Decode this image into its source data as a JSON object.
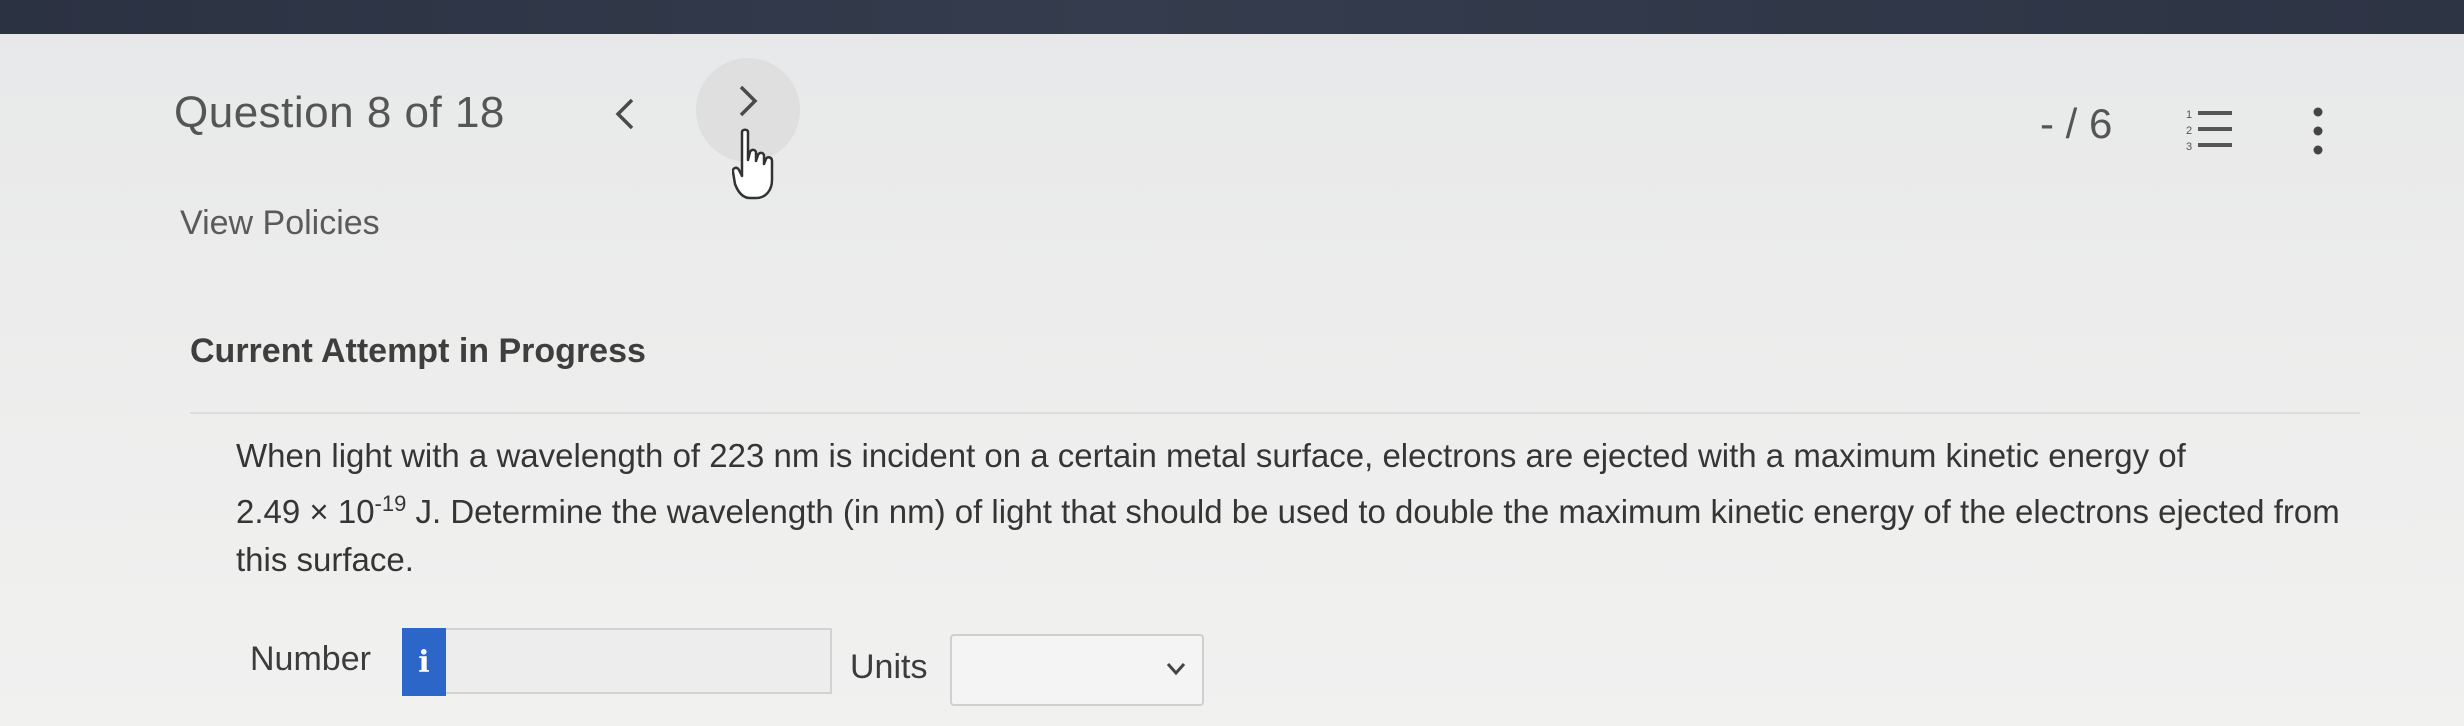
{
  "header": {
    "question_counter": "Question 8 of 18",
    "prev_icon": "chevron-left-icon",
    "next_icon": "chevron-right-icon",
    "score": "- / 6",
    "list_icon": "numbered-list-icon",
    "more_icon": "more-vertical-icon"
  },
  "view_policies": "View Policies",
  "attempt_heading": "Current Attempt in Progress",
  "question": {
    "text_1": "When light with a wavelength of 223 nm is incident on a certain metal surface, electrons are ejected with a maximum kinetic energy of",
    "coefficient": "2.49 × 10",
    "exponent": "-19",
    "text_2": " J. Determine the wavelength (in nm) of light that should be used to double the maximum kinetic energy of the electrons ejected from this surface."
  },
  "answer": {
    "number_label": "Number",
    "info_label": "i",
    "number_value": "",
    "units_label": "Units",
    "units_value": ""
  },
  "colors": {
    "top_bar": "#2b3242",
    "info_button": "#2b66c8"
  }
}
